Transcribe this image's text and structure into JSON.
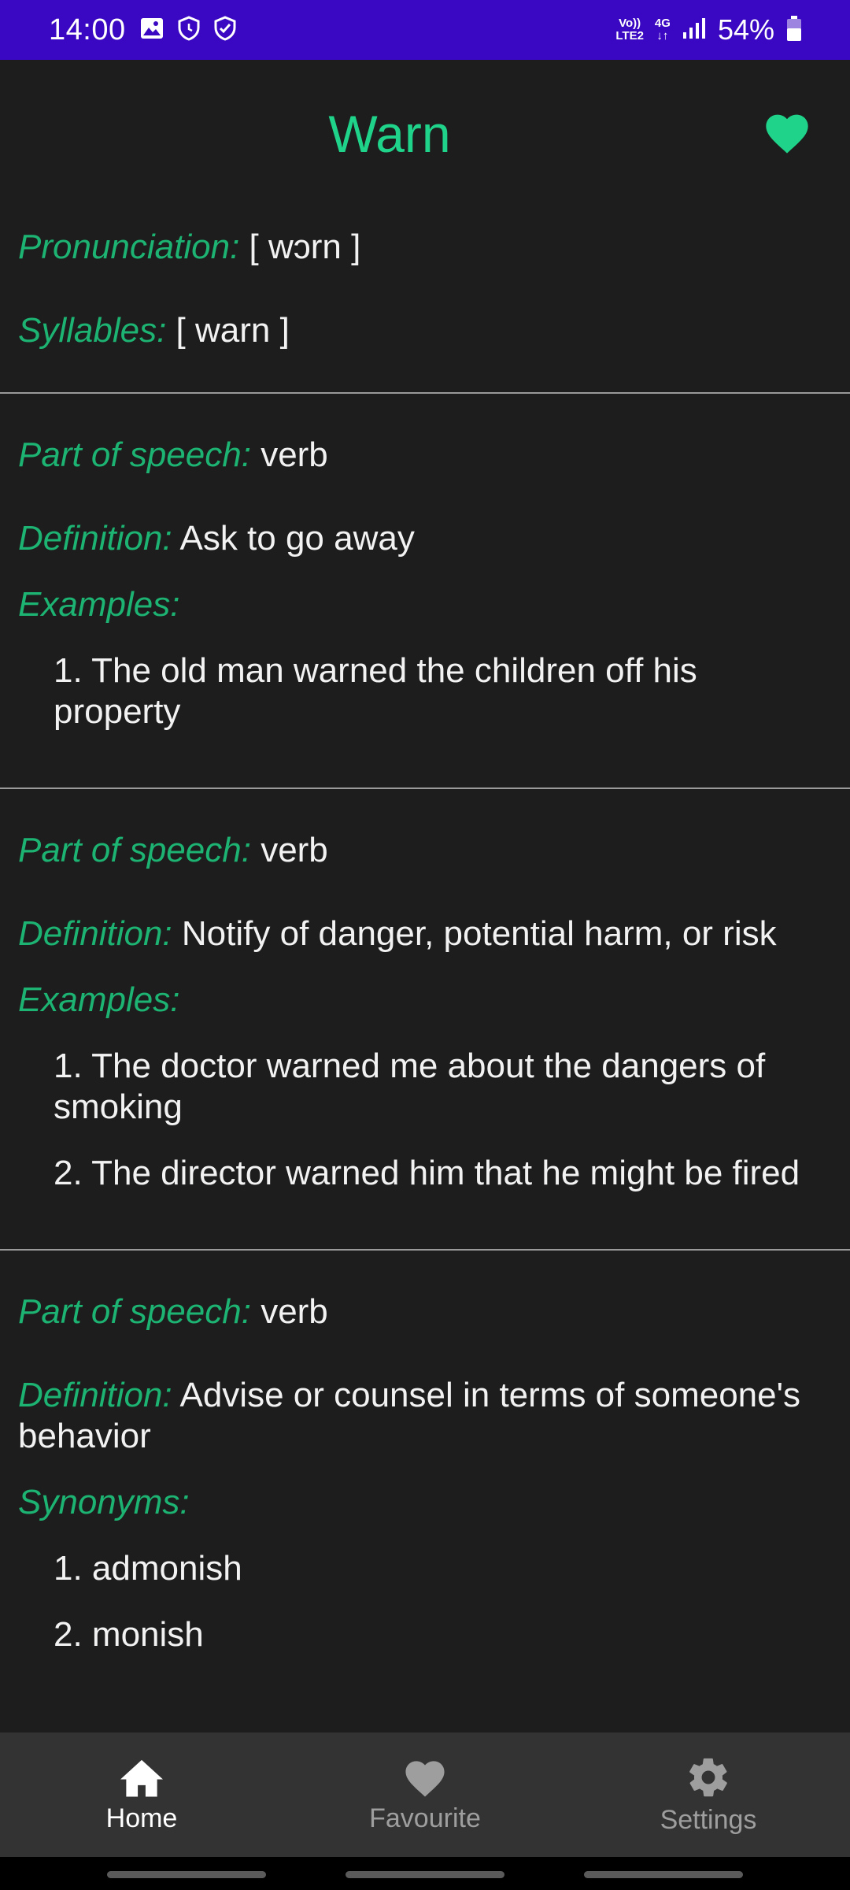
{
  "status": {
    "time": "14:00",
    "network_top": "Vo))",
    "network_bottom": "LTE2",
    "net_type": "4G",
    "battery": "54%"
  },
  "header": {
    "word": "Warn",
    "favourite_icon": "heart-icon"
  },
  "info": {
    "pronunciation_label": "Pronunciation:",
    "pronunciation_value": "[ wɔrn ]",
    "syllables_label": "Syllables:",
    "syllables_value": "[ warn ]"
  },
  "meanings": [
    {
      "pos_label": "Part of speech:",
      "pos_value": "verb",
      "def_label": "Definition:",
      "def_value": "Ask to go away",
      "list_label": "Examples:",
      "items": [
        "1. The old man warned the children off his property"
      ]
    },
    {
      "pos_label": "Part of speech:",
      "pos_value": "verb",
      "def_label": "Definition:",
      "def_value": "Notify of danger, potential harm, or risk",
      "list_label": "Examples:",
      "items": [
        "1. The doctor warned me about the dangers of smoking",
        "2. The director warned him that he might be fired"
      ]
    },
    {
      "pos_label": "Part of speech:",
      "pos_value": "verb",
      "def_label": "Definition:",
      "def_value": "Advise or counsel in terms of someone's behavior",
      "list_label": "Synonyms:",
      "items": [
        "1. admonish",
        "2. monish"
      ]
    }
  ],
  "nav": {
    "home": "Home",
    "favourite": "Favourite",
    "settings": "Settings"
  },
  "colors": {
    "accent": "#1fd48a",
    "status_bar": "#3a08c2",
    "background": "#1c1d1c"
  }
}
